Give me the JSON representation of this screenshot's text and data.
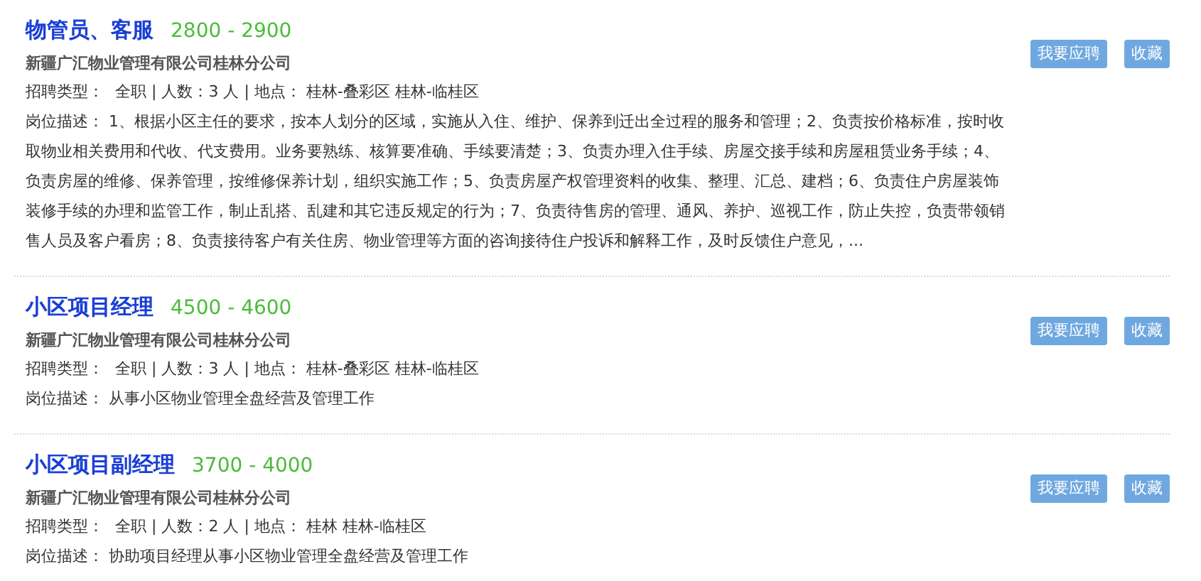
{
  "jobs": [
    {
      "title": "物管员、客服",
      "salary": "2800 - 2900",
      "company": "新疆广汇物业管理有限公司桂林分公司",
      "info_label": "招聘类型：",
      "info": "全职 | 人数：3 人 | 地点： 桂林-叠彩区 桂林-临桂区",
      "description_label": "岗位描述：",
      "description": "1、根据小区主任的要求，按本人划分的区域，实施从入住、维护、保养到迁出全过程的服务和管理；2、负责按价格标准，按时收取物业相关费用和代收、代支费用。业务要熟练、核算要准确、手续要清楚；3、负责办理入住手续、房屋交接手续和房屋租赁业务手续；4、负责房屋的维修、保养管理，按维修保养计划，组织实施工作；5、负责房屋产权管理资料的收集、整理、汇总、建档；6、负责住户房屋装饰装修手续的办理和监管工作，制止乱搭、乱建和其它违反规定的行为；7、负责待售房的管理、通风、养护、巡视工作，防止失控，负责带领销售人员及客户看房；8、负责接待客户有关住房、物业管理等方面的咨询接待住户投诉和解释工作，及时反馈住户意见，...",
      "apply_button": "我要应聘",
      "save_button": "收藏"
    },
    {
      "title": "小区项目经理",
      "salary": "4500 - 4600",
      "company": "新疆广汇物业管理有限公司桂林分公司",
      "info_label": "招聘类型：",
      "info": "全职 | 人数：3 人 | 地点： 桂林-叠彩区 桂林-临桂区",
      "description_label": "岗位描述：",
      "description": "从事小区物业管理全盘经营及管理工作",
      "apply_button": "我要应聘",
      "save_button": "收藏"
    },
    {
      "title": "小区项目副经理",
      "salary": "3700 - 4000",
      "company": "新疆广汇物业管理有限公司桂林分公司",
      "info_label": "招聘类型：",
      "info": "全职 | 人数：2 人 | 地点： 桂林 桂林-临桂区",
      "description_label": "岗位描述：",
      "description": "协助项目经理从事小区物业管理全盘经营及管理工作",
      "apply_button": "我要应聘",
      "save_button": "收藏"
    }
  ]
}
